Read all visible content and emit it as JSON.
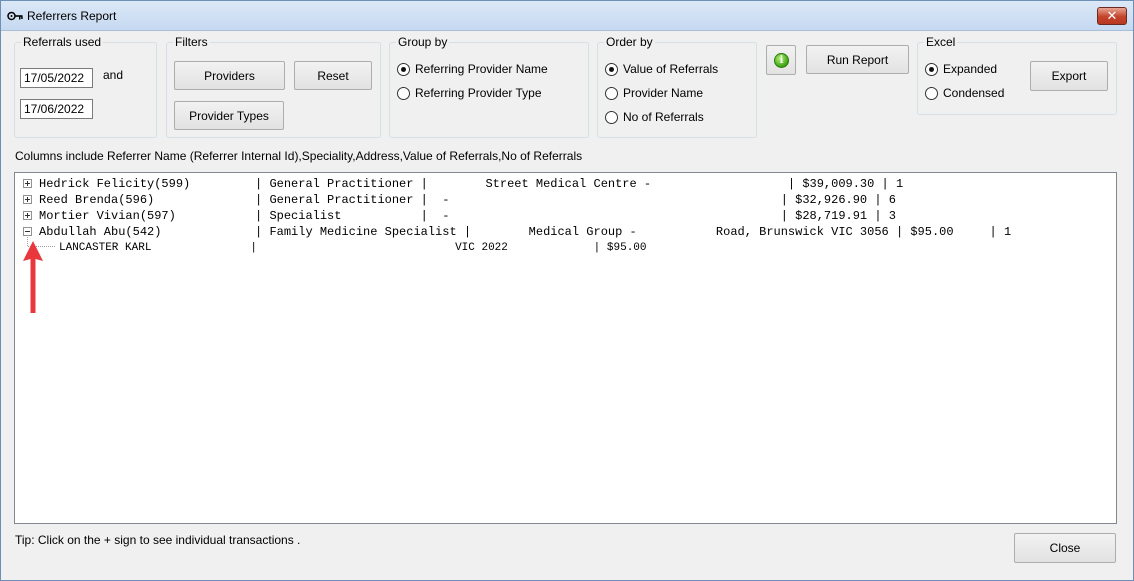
{
  "window": {
    "title": "Referrers Report",
    "close_glyph": "✕",
    "title_icon": "key-icon"
  },
  "referrals_used": {
    "label": "Referrals used",
    "from_date": "17/05/2022",
    "and_label": "and",
    "to_date": "17/06/2022"
  },
  "filters": {
    "label": "Filters",
    "providers_button": "Providers",
    "reset_button": "Reset",
    "provider_types_button": "Provider Types"
  },
  "group_by": {
    "label": "Group by",
    "options": [
      {
        "label": "Referring Provider Name",
        "checked": true
      },
      {
        "label": "Referring Provider Type",
        "checked": false
      }
    ]
  },
  "order_by": {
    "label": "Order by",
    "options": [
      {
        "label": "Value of Referrals",
        "checked": true
      },
      {
        "label": "Provider Name",
        "checked": false
      },
      {
        "label": "No of Referrals",
        "checked": false
      }
    ]
  },
  "info_glyph": "i",
  "run_report_button": "Run Report",
  "excel": {
    "label": "Excel",
    "options": [
      {
        "label": "Expanded",
        "checked": true
      },
      {
        "label": "Condensed",
        "checked": false
      }
    ],
    "export_button": "Export"
  },
  "columns_note": "Columns include Referrer Name (Referrer Internal Id),Speciality,Address,Value of Referrals,No of Referrals",
  "tree": {
    "rows": [
      {
        "text": "Hedrick Felicity(599)         | General Practitioner |        Street Medical Centre -                   | $39,009.30 | 1",
        "expanded": false
      },
      {
        "text": "Reed Brenda(596)              | General Practitioner |  -                                              | $32,926.90 | 6",
        "expanded": false
      },
      {
        "text": "Mortier Vivian(597)           | Specialist           |  -                                              | $28,719.91 | 3",
        "expanded": false
      },
      {
        "text": "Abdullah Abu(542)             | Family Medicine Specialist |        Medical Group -           Road, Brunswick VIC 3056 | $95.00     | 1",
        "expanded": true
      }
    ],
    "child_rows": [
      {
        "text": "LANCASTER KARL               |                              VIC 2022             | $95.00"
      }
    ]
  },
  "tip": "Tip: Click on the + sign to see individual transactions .",
  "close_button": "Close",
  "colors": {
    "arrow": "#e8383d",
    "title_gradient_top": "#dbe8f7",
    "accent_green": "#3aa412"
  }
}
